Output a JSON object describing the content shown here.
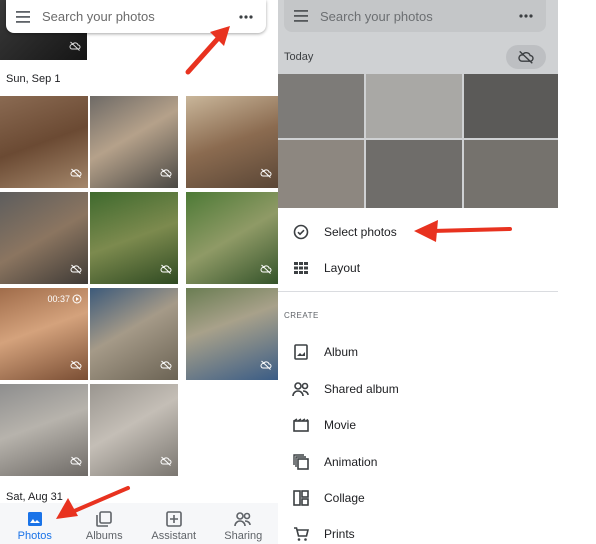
{
  "left": {
    "search": {
      "placeholder": "Search your photos",
      "menu_icon": "hamburger-menu-icon",
      "more_icon": "more-options-icon"
    },
    "sections": [
      {
        "date": "Sun, Sep 1"
      },
      {
        "date": "Sat, Aug 31"
      }
    ],
    "video_duration": "00:37",
    "nav": [
      {
        "label": "Photos",
        "icon": "photos-icon",
        "active": true
      },
      {
        "label": "Albums",
        "icon": "albums-icon",
        "active": false
      },
      {
        "label": "Assistant",
        "icon": "assistant-icon",
        "active": false
      },
      {
        "label": "Sharing",
        "icon": "sharing-icon",
        "active": false
      }
    ]
  },
  "right": {
    "search": {
      "placeholder": "Search your photos"
    },
    "today_label": "Today",
    "menu": [
      {
        "label": "Select photos",
        "icon": "check-circle-icon"
      },
      {
        "label": "Layout",
        "icon": "grid-layout-icon"
      }
    ],
    "create_section": "CREATE",
    "create_items": [
      {
        "label": "Album",
        "icon": "album-icon"
      },
      {
        "label": "Shared album",
        "icon": "shared-album-icon"
      },
      {
        "label": "Movie",
        "icon": "movie-icon"
      },
      {
        "label": "Animation",
        "icon": "animation-icon"
      },
      {
        "label": "Collage",
        "icon": "collage-icon"
      },
      {
        "label": "Prints",
        "icon": "prints-cart-icon"
      }
    ]
  },
  "colors": {
    "accent": "#1a73e8",
    "annotation_arrow": "#e8321f",
    "overlay": "#cfd1d3"
  }
}
